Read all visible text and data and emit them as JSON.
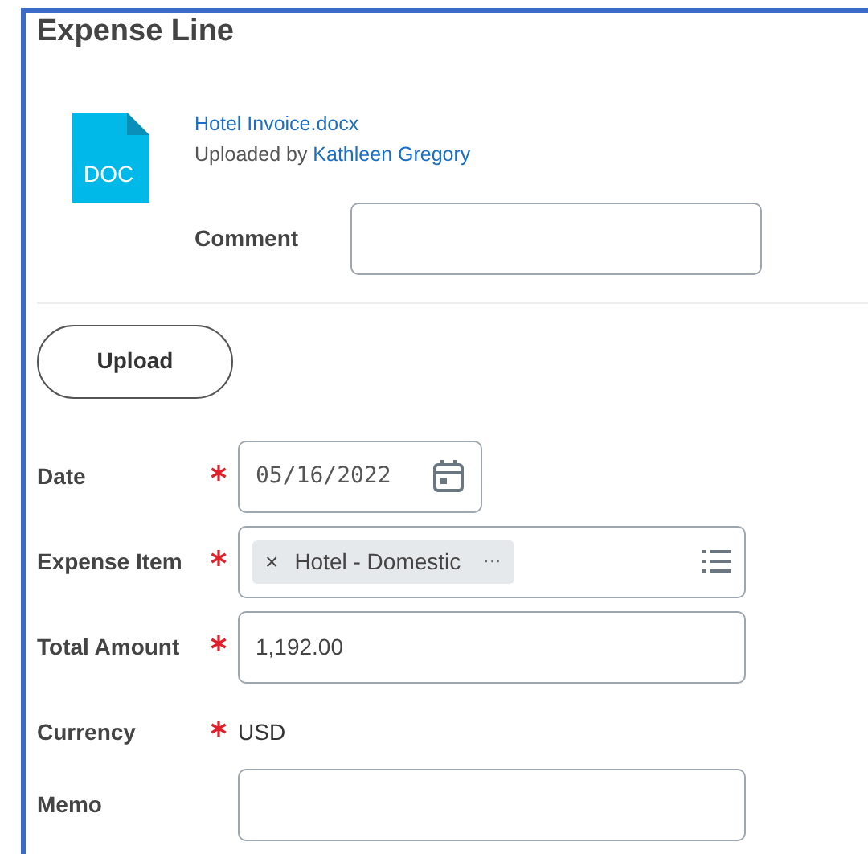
{
  "title": "Expense Line",
  "attachment": {
    "file_name": "Hotel Invoice.docx",
    "uploaded_by_label": "Uploaded by",
    "uploader": "Kathleen Gregory",
    "file_type": "DOC",
    "comment_label": "Comment"
  },
  "upload_button": "Upload",
  "fields": [
    {
      "kind": "date",
      "label": "Date",
      "required": true,
      "value": "05/16/2022"
    },
    {
      "kind": "multiselect",
      "label": "Expense Item",
      "required": true,
      "tokens": [
        {
          "text": "Hotel - Domestic",
          "remove": "×",
          "more": "···"
        }
      ]
    },
    {
      "kind": "text",
      "label": "Total Amount",
      "required": true,
      "value": "1,192.00"
    },
    {
      "kind": "readonly",
      "label": "Currency",
      "required": true,
      "value": "USD"
    },
    {
      "kind": "text",
      "label": "Memo",
      "required": false
    }
  ]
}
